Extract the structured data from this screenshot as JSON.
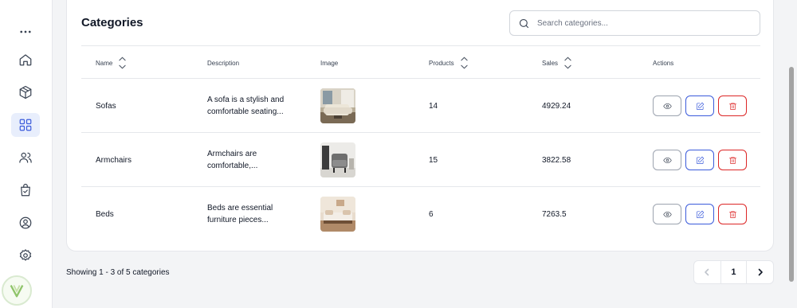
{
  "sidebar": {
    "items": [
      {
        "icon": "more-icon"
      },
      {
        "icon": "home-icon"
      },
      {
        "icon": "box-icon"
      },
      {
        "icon": "grid-icon",
        "active": true
      },
      {
        "icon": "users-icon"
      },
      {
        "icon": "bag-check-icon"
      },
      {
        "icon": "user-circle-icon"
      },
      {
        "icon": "settings-icon"
      }
    ],
    "logo_icon": "brand-logo-icon"
  },
  "header": {
    "title": "Categories",
    "search_placeholder": "Search categories..."
  },
  "table": {
    "columns": {
      "name": "Name",
      "description": "Description",
      "image": "Image",
      "products": "Products",
      "sales": "Sales",
      "actions": "Actions"
    },
    "rows": [
      {
        "name": "Sofas",
        "description": "A sofa is a stylish and comfortable seating...",
        "image": "sofa-photo",
        "products": "14",
        "sales": "4929.24"
      },
      {
        "name": "Armchairs",
        "description": "Armchairs are comfortable,...",
        "image": "armchair-photo",
        "products": "15",
        "sales": "3822.58"
      },
      {
        "name": "Beds",
        "description": "Beds are essential furniture pieces...",
        "image": "bed-photo",
        "products": "6",
        "sales": "7263.5"
      }
    ]
  },
  "footer": {
    "showing": "Showing 1 - 3 of 5 categories",
    "current_page": "1"
  },
  "colors": {
    "accent": "#3b5bdb",
    "danger": "#dc2626",
    "active_bg": "#e8eefc"
  }
}
